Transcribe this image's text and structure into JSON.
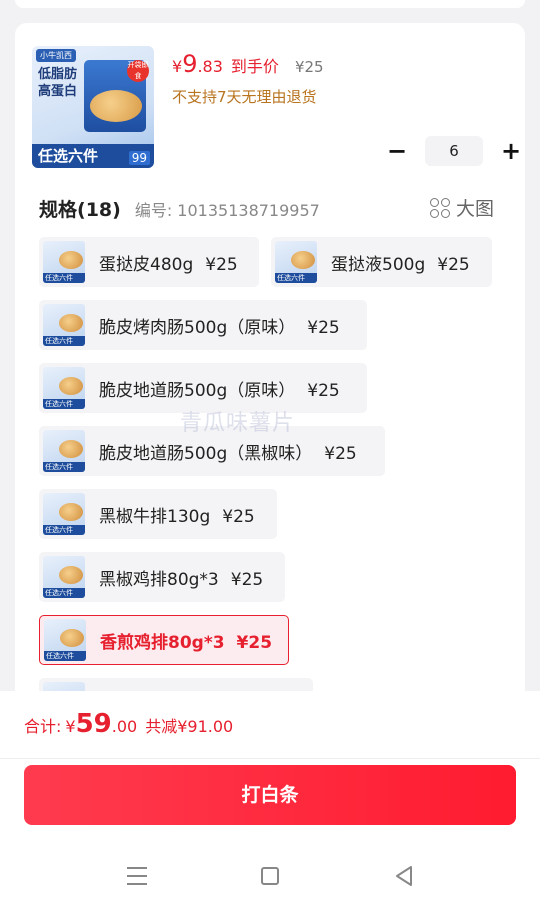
{
  "product": {
    "thumb_brand": "小牛凯西",
    "thumb_tagline": "低脂肪高蛋白",
    "thumb_seal": "开袋即食",
    "thumb_bar_text": "任选六件",
    "thumb_bar_num": "99",
    "price_symbol": "¥",
    "price_int": "9",
    "price_dec": ".83",
    "price_note": "到手价",
    "price_original": "¥25",
    "return_note": "不支持7天无理由退货"
  },
  "stepper": {
    "minus": "−",
    "value": "6",
    "plus": "+"
  },
  "spec": {
    "title": "规格",
    "count": "(18)",
    "code": "编号: 10135138719957",
    "bigpic_label": "大图"
  },
  "options": [
    {
      "name": "蛋挞皮480g",
      "price": "¥25",
      "mini": "任选六件"
    },
    {
      "name": "蛋挞液500g",
      "price": "¥25",
      "mini": "任选六件"
    },
    {
      "name": "脆皮烤肉肠500g（原味）",
      "price": "¥25",
      "mini": "任选六件"
    },
    {
      "name": "脆皮地道肠500g（原味）",
      "price": "¥25",
      "mini": "任选六件"
    },
    {
      "name": "脆皮地道肠500g（黑椒味）",
      "price": "¥25",
      "mini": "任选六件"
    },
    {
      "name": "黑椒牛排130g",
      "price": "¥25",
      "mini": "任选六件"
    },
    {
      "name": "黑椒鸡排80g*3",
      "price": "¥25",
      "mini": "任选六件"
    },
    {
      "name": "香煎鸡排80g*3",
      "price": "¥25",
      "mini": "任选六件",
      "selected": true
    }
  ],
  "watermark": "青瓜味薯片",
  "footer": {
    "total_label": "合计:",
    "total_symbol": "¥",
    "total_int": "59",
    "total_dec": ".00",
    "total_save": "共减¥91.00",
    "buy_label": "打白条"
  },
  "colors": {
    "accent": "#e6202f",
    "warning": "#b8741f",
    "brand_blue": "#1d4d9c"
  },
  "icons": {
    "bigpic": "grid-icon",
    "nav_menu": "menu-icon",
    "nav_home": "home-icon",
    "nav_back": "back-icon"
  }
}
